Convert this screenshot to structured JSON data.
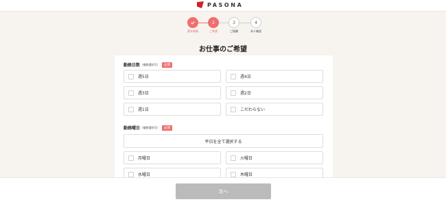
{
  "brand": {
    "name": "PASONA"
  },
  "stepper": {
    "steps": [
      {
        "number": "",
        "label": "基本情報",
        "state": "done"
      },
      {
        "number": "2",
        "label": "ご希望",
        "state": "current"
      },
      {
        "number": "3",
        "label": "ご経験",
        "state": "upcoming"
      },
      {
        "number": "4",
        "label": "本人確認",
        "state": "upcoming"
      }
    ]
  },
  "page": {
    "title": "お仕事のご希望"
  },
  "sections": {
    "days": {
      "label": "勤務日数",
      "note": "(複数選択可)",
      "badge": "必須",
      "options": [
        "週5日",
        "週4日",
        "週3日",
        "週2日",
        "週1日",
        "こだわらない"
      ]
    },
    "weekdays": {
      "label": "勤務曜日",
      "note": "(複数選択可)",
      "badge": "必須",
      "select_all": "平日を全て選択する",
      "options": [
        "月曜日",
        "火曜日",
        "水曜日",
        "木曜日"
      ]
    }
  },
  "footer": {
    "next_label": "次へ",
    "next_enabled": false
  },
  "colors": {
    "accent": "#ef6f6f",
    "brand": "#d42028",
    "disabled": "#bbbbbb",
    "background": "#f7f3ef"
  }
}
